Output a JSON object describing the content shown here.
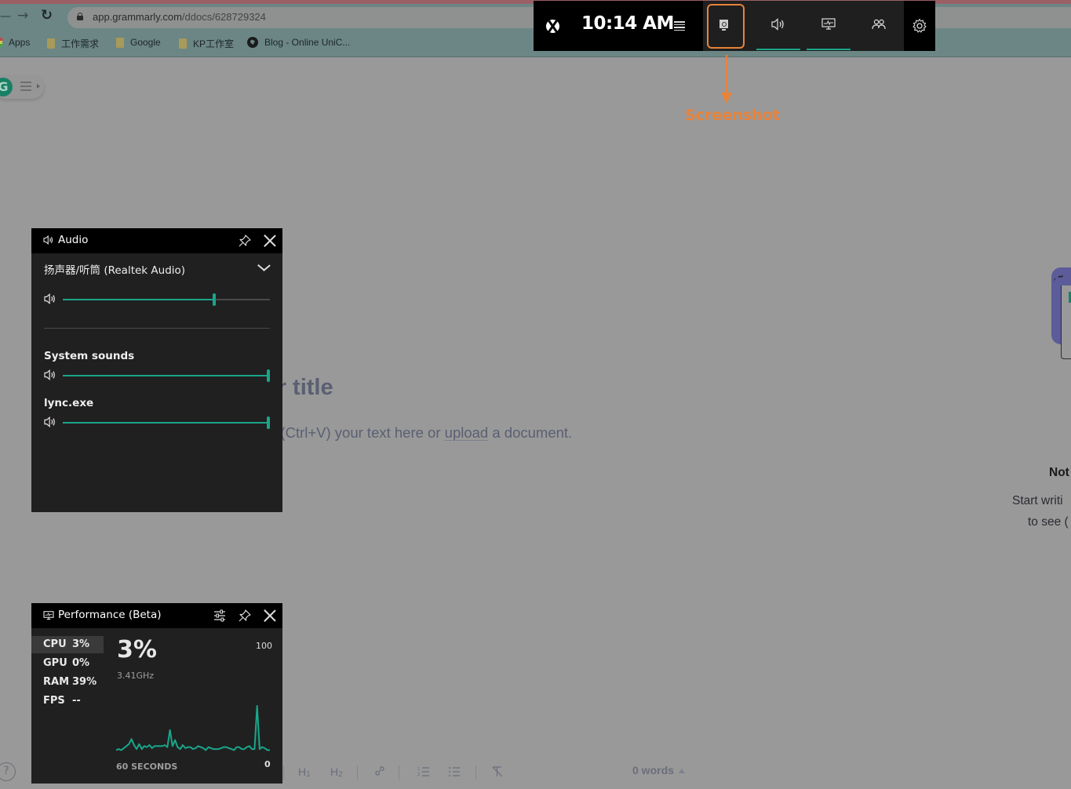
{
  "browser": {
    "url_host": "app.grammarly.com",
    "url_path": "/ddocs/628729324",
    "bookmarks": [
      {
        "label": "Apps",
        "icon": "apps-icon"
      },
      {
        "label": "工作需求",
        "icon": "folder-icon"
      },
      {
        "label": "Google",
        "icon": "folder-icon"
      },
      {
        "label": "KP工作室",
        "icon": "folder-icon"
      },
      {
        "label": "Blog - Online UniC...",
        "icon": "globe-icon"
      }
    ]
  },
  "gamebar": {
    "time": "10:14 AM",
    "buttons": [
      {
        "name": "capture",
        "icon": "capture-icon",
        "selected": true,
        "active": false
      },
      {
        "name": "audio",
        "icon": "speaker-icon",
        "selected": false,
        "active": true
      },
      {
        "name": "performance",
        "icon": "performance-icon",
        "selected": false,
        "active": true
      },
      {
        "name": "social",
        "icon": "social-icon",
        "selected": false,
        "active": false
      }
    ],
    "accent_color": "#1aa58a",
    "selection_color": "#e8833a"
  },
  "annotation": {
    "label": "Screenshot"
  },
  "audio_widget": {
    "title": "Audio",
    "device": "扬声器/听筒 (Realtek Audio)",
    "master_volume_percent": 73,
    "apps": [
      {
        "name": "System sounds",
        "volume_percent": 100
      },
      {
        "name": "lync.exe",
        "volume_percent": 100
      }
    ]
  },
  "performance_widget": {
    "title": "Performance (Beta)",
    "metrics": [
      {
        "name": "CPU",
        "value": "3%",
        "active": true
      },
      {
        "name": "GPU",
        "value": "0%",
        "active": false
      },
      {
        "name": "RAM",
        "value": "39%",
        "active": false
      },
      {
        "name": "FPS",
        "value": "--",
        "active": false
      }
    ],
    "big_value": "3%",
    "frequency": "3.41GHz",
    "y_max_label": "100",
    "y_min_label": "0",
    "x_label": "60 SECONDS"
  },
  "chart_data": {
    "type": "line",
    "title": "CPU",
    "xlabel": "60 SECONDS",
    "ylabel": "",
    "ylim": [
      0,
      100
    ],
    "x": [
      0,
      1,
      2,
      3,
      4,
      5,
      6,
      7,
      8,
      9,
      10,
      11,
      12,
      13,
      14,
      15,
      16,
      17,
      18,
      19,
      20,
      21,
      22,
      23,
      24,
      25,
      26,
      27,
      28,
      29,
      30,
      31,
      32,
      33,
      34,
      35,
      36,
      37,
      38,
      39,
      40,
      41,
      42,
      43,
      44,
      45,
      46,
      47,
      48,
      49,
      50,
      51,
      52,
      53,
      54,
      55,
      56,
      57,
      58,
      59,
      60
    ],
    "series": [
      {
        "name": "CPU usage",
        "values": [
          2,
          3,
          2,
          4,
          6,
          8,
          13,
          7,
          3,
          8,
          3,
          6,
          5,
          7,
          4,
          6,
          6,
          6,
          6,
          7,
          5,
          22,
          6,
          12,
          5,
          3,
          7,
          4,
          5,
          5,
          3,
          4,
          6,
          5,
          4,
          2,
          5,
          4,
          3,
          3,
          3,
          4,
          5,
          5,
          4,
          3,
          2,
          5,
          5,
          3,
          3,
          5,
          6,
          3,
          3,
          46,
          3,
          5,
          4,
          2,
          2
        ]
      }
    ]
  },
  "grammarly": {
    "title_fragment": "ur title",
    "hint_before": "e (Ctrl+V) your text here or ",
    "hint_link": "upload",
    "hint_after": " a document.",
    "side_title": "Not",
    "side_line1": "Start writi",
    "side_line2": "to see (",
    "help": "?",
    "format_buttons": [
      {
        "name": "heading-1",
        "label": "H",
        "sub": "1"
      },
      {
        "name": "heading-2",
        "label": "H",
        "sub": "2"
      }
    ],
    "word_count": "0 words"
  }
}
